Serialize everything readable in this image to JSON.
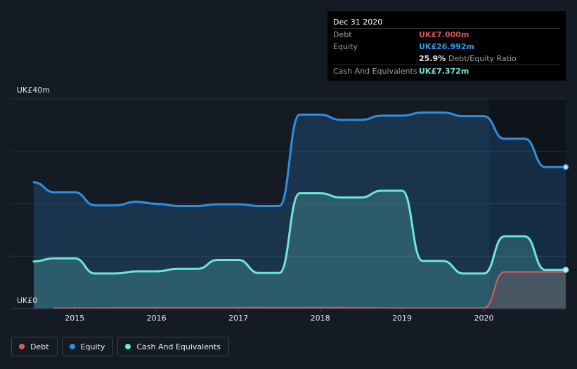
{
  "tooltip": {
    "date": "Dec 31 2020",
    "rows": [
      {
        "key": "Debt",
        "value": "UK£7.000m",
        "color": "#e05050"
      },
      {
        "key": "Equity",
        "value": "UK£26.992m",
        "color": "#2f9bea"
      },
      {
        "key": "",
        "value": "25.9%",
        "extra": "Debt/Equity Ratio",
        "color": "#ffffff"
      },
      {
        "key": "Cash And Equivalents",
        "value": "UK£7.372m",
        "color": "#73e6d4"
      }
    ]
  },
  "legend": [
    {
      "label": "Debt",
      "color": "#e05a5a"
    },
    {
      "label": "Equity",
      "color": "#2f8fe0"
    },
    {
      "label": "Cash And Equivalents",
      "color": "#6ee7d6"
    }
  ],
  "chart_data": {
    "type": "area",
    "y_axis_labels": [
      "UK£40m",
      "UK£0"
    ],
    "ylim": [
      0,
      40
    ],
    "xlim": [
      2014.5,
      2021.0
    ],
    "x_ticks": [
      2015,
      2016,
      2017,
      2018,
      2019,
      2020
    ],
    "x_tick_labels": [
      "2015",
      "2016",
      "2017",
      "2018",
      "2019",
      "2020"
    ],
    "grid": true,
    "legend_position": "bottom-left",
    "series": [
      {
        "name": "Equity",
        "color": "#2f8fe0",
        "points": [
          [
            2014.5,
            24.1
          ],
          [
            2014.75,
            22.2
          ],
          [
            2015.0,
            22.2
          ],
          [
            2015.25,
            19.7
          ],
          [
            2015.5,
            19.7
          ],
          [
            2015.75,
            20.4
          ],
          [
            2016.0,
            20.0
          ],
          [
            2016.25,
            19.6
          ],
          [
            2016.5,
            19.6
          ],
          [
            2016.75,
            19.9
          ],
          [
            2017.0,
            19.9
          ],
          [
            2017.25,
            19.6
          ],
          [
            2017.5,
            19.6
          ],
          [
            2017.75,
            37.0
          ],
          [
            2018.0,
            37.0
          ],
          [
            2018.25,
            36.0
          ],
          [
            2018.5,
            36.0
          ],
          [
            2018.75,
            36.8
          ],
          [
            2019.0,
            36.8
          ],
          [
            2019.25,
            37.4
          ],
          [
            2019.5,
            37.4
          ],
          [
            2019.75,
            36.7
          ],
          [
            2020.0,
            36.7
          ],
          [
            2020.25,
            32.4
          ],
          [
            2020.5,
            32.4
          ],
          [
            2020.75,
            27.0
          ],
          [
            2021.0,
            27.0
          ]
        ]
      },
      {
        "name": "Cash And Equivalents",
        "color": "#6ee7d6",
        "points": [
          [
            2014.5,
            9.0
          ],
          [
            2014.75,
            9.6
          ],
          [
            2015.0,
            9.6
          ],
          [
            2015.25,
            6.7
          ],
          [
            2015.5,
            6.7
          ],
          [
            2015.75,
            7.1
          ],
          [
            2016.0,
            7.1
          ],
          [
            2016.25,
            7.6
          ],
          [
            2016.5,
            7.6
          ],
          [
            2016.75,
            9.3
          ],
          [
            2017.0,
            9.3
          ],
          [
            2017.25,
            6.8
          ],
          [
            2017.5,
            6.8
          ],
          [
            2017.75,
            22.0
          ],
          [
            2018.0,
            22.0
          ],
          [
            2018.25,
            21.2
          ],
          [
            2018.5,
            21.2
          ],
          [
            2018.75,
            22.5
          ],
          [
            2019.0,
            22.5
          ],
          [
            2019.25,
            9.1
          ],
          [
            2019.5,
            9.1
          ],
          [
            2019.75,
            6.7
          ],
          [
            2020.0,
            6.7
          ],
          [
            2020.25,
            13.8
          ],
          [
            2020.5,
            13.8
          ],
          [
            2020.75,
            7.4
          ],
          [
            2021.0,
            7.4
          ]
        ]
      },
      {
        "name": "Debt",
        "color": "#e05a5a",
        "points": [
          [
            2014.75,
            0.1
          ],
          [
            2018.0,
            0.2
          ],
          [
            2019.0,
            0.1
          ],
          [
            2020.0,
            0.1
          ],
          [
            2020.25,
            7.0
          ],
          [
            2021.0,
            7.0
          ]
        ]
      }
    ]
  }
}
